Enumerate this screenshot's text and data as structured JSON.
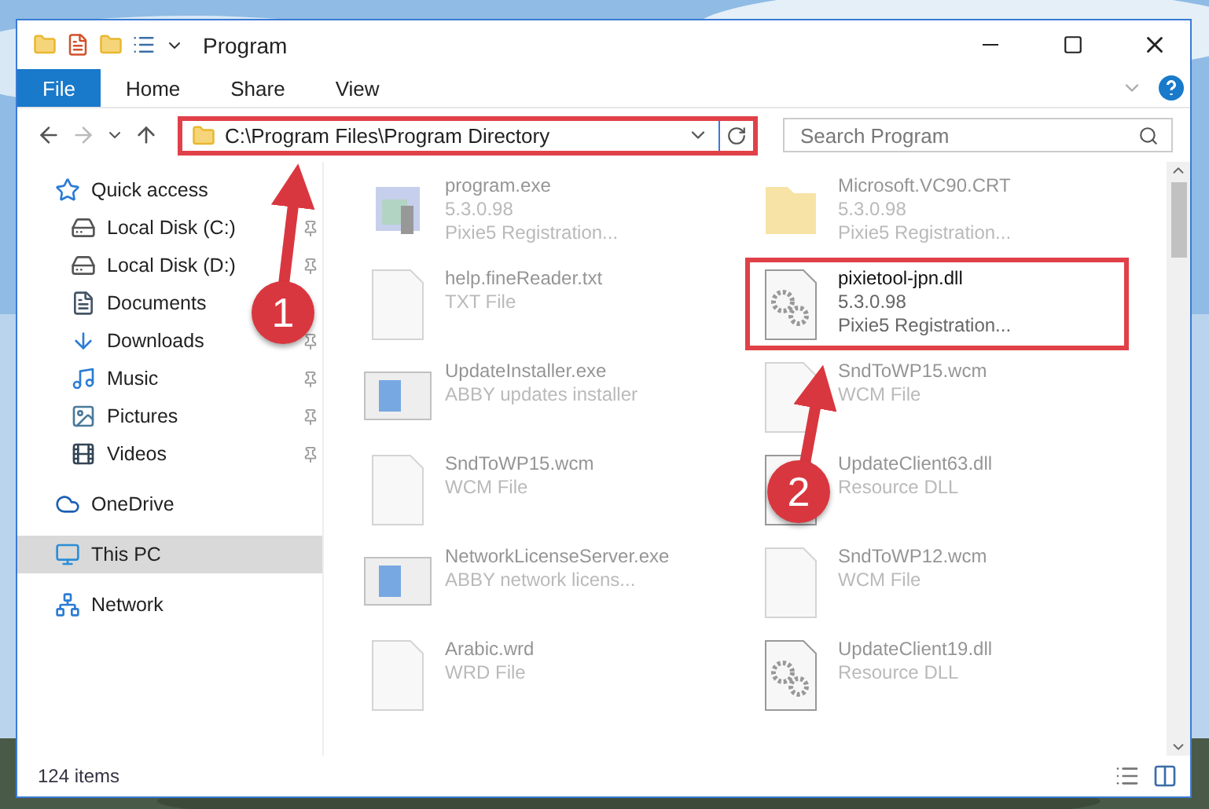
{
  "window": {
    "title": "Program"
  },
  "ribbon_tabs": [
    {
      "label": "File",
      "selected": true
    },
    {
      "label": "Home",
      "selected": false
    },
    {
      "label": "Share",
      "selected": false
    },
    {
      "label": "View",
      "selected": false
    }
  ],
  "address_bar": {
    "path": "C:\\Program Files\\Program Directory",
    "highlighted": true
  },
  "search": {
    "placeholder": "Search Program"
  },
  "sidebar": {
    "items": [
      {
        "label": "Quick access",
        "selected": false,
        "children": [
          {
            "label": "Local Disk (C:)",
            "pinned": true,
            "selected": false
          },
          {
            "label": "Local Disk (D:)",
            "pinned": true,
            "selected": false
          },
          {
            "label": "Documents",
            "pinned": false,
            "selected": false
          },
          {
            "label": "Downloads",
            "pinned": true,
            "selected": false
          },
          {
            "label": "Music",
            "pinned": true,
            "selected": false
          },
          {
            "label": "Pictures",
            "pinned": true,
            "selected": false
          },
          {
            "label": "Videos",
            "pinned": true,
            "selected": false
          }
        ]
      },
      {
        "label": "OneDrive",
        "selected": false
      },
      {
        "label": "This PC",
        "selected": true
      },
      {
        "label": "Network",
        "selected": false
      }
    ]
  },
  "files": [
    {
      "name": "program.exe",
      "lines": [
        "5.3.0.98",
        "Pixie5 Registration..."
      ],
      "kind": "app",
      "faded": true,
      "highlighted": false
    },
    {
      "name": "Microsoft.VC90.CRT",
      "lines": [
        "5.3.0.98",
        "Pixie5 Registration..."
      ],
      "kind": "folder",
      "faded": true,
      "highlighted": false
    },
    {
      "name": "help.fineReader.txt",
      "lines": [
        "TXT File"
      ],
      "kind": "text",
      "faded": true,
      "highlighted": false
    },
    {
      "name": "pixietool-jpn.dll",
      "lines": [
        "5.3.0.98",
        "Pixie5 Registration..."
      ],
      "kind": "dll",
      "faded": false,
      "highlighted": true
    },
    {
      "name": "UpdateInstaller.exe",
      "lines": [
        "ABBY updates installer"
      ],
      "kind": "window",
      "faded": true,
      "highlighted": false
    },
    {
      "name": "SndToWP15.wcm",
      "lines": [
        "WCM File"
      ],
      "kind": "text",
      "faded": true,
      "highlighted": false
    },
    {
      "name": "SndToWP15.wcm",
      "lines": [
        "WCM File"
      ],
      "kind": "text",
      "faded": true,
      "highlighted": false
    },
    {
      "name": "UpdateClient63.dll",
      "lines": [
        "Resource DLL"
      ],
      "kind": "dll",
      "faded": true,
      "highlighted": false
    },
    {
      "name": "NetworkLicenseServer.exe",
      "lines": [
        "ABBY network licens..."
      ],
      "kind": "window",
      "faded": true,
      "highlighted": false
    },
    {
      "name": "SndToWP12.wcm",
      "lines": [
        "WCM File"
      ],
      "kind": "text",
      "faded": true,
      "highlighted": false
    },
    {
      "name": "Arabic.wrd",
      "lines": [
        "WRD File"
      ],
      "kind": "text",
      "faded": true,
      "highlighted": false
    },
    {
      "name": "UpdateClient19.dll",
      "lines": [
        "Resource DLL"
      ],
      "kind": "dll",
      "faded": true,
      "highlighted": false
    }
  ],
  "status_bar": {
    "item_count": "124 items"
  },
  "callouts": [
    {
      "number": "1"
    },
    {
      "number": "2"
    }
  ]
}
